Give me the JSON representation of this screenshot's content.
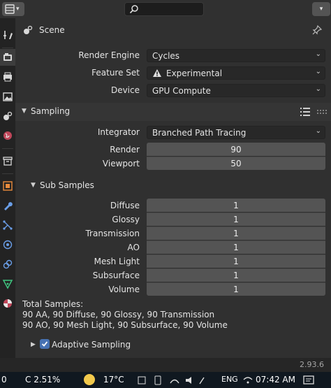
{
  "header": {
    "editor_icon": "properties-editor-icon",
    "search_icon": "search-icon",
    "options_icon": "chevron-down-icon"
  },
  "tabs": [
    {
      "name": "tool",
      "icon": "tool-icon"
    },
    {
      "name": "render",
      "icon": "render-camera-icon",
      "active": true
    },
    {
      "name": "output",
      "icon": "printer-icon"
    },
    {
      "name": "view-layer",
      "icon": "image-icon"
    },
    {
      "name": "scene",
      "icon": "scene-icon"
    },
    {
      "name": "world",
      "icon": "world-icon"
    },
    {
      "name": "collection",
      "icon": "collection-box-icon"
    },
    {
      "name": "object",
      "icon": "object-square-icon"
    },
    {
      "name": "modifiers",
      "icon": "wrench-icon"
    },
    {
      "name": "particles",
      "icon": "particles-icon"
    },
    {
      "name": "physics",
      "icon": "physics-orbit-icon"
    },
    {
      "name": "constraints",
      "icon": "constraint-icon"
    },
    {
      "name": "data",
      "icon": "mesh-data-icon"
    },
    {
      "name": "material",
      "icon": "material-sphere-icon"
    }
  ],
  "context": {
    "scene_label": "Scene"
  },
  "render_settings": {
    "render_engine_label": "Render Engine",
    "render_engine_value": "Cycles",
    "feature_set_label": "Feature Set",
    "feature_set_value": "Experimental",
    "device_label": "Device",
    "device_value": "GPU Compute"
  },
  "sampling": {
    "title": "Sampling",
    "integrator_label": "Integrator",
    "integrator_value": "Branched Path Tracing",
    "render_label": "Render",
    "render_value": "90",
    "viewport_label": "Viewport",
    "viewport_value": "50"
  },
  "sub_samples": {
    "title": "Sub Samples",
    "rows": [
      {
        "label": "Diffuse",
        "value": "1"
      },
      {
        "label": "Glossy",
        "value": "1"
      },
      {
        "label": "Transmission",
        "value": "1"
      },
      {
        "label": "AO",
        "value": "1"
      },
      {
        "label": "Mesh Light",
        "value": "1"
      },
      {
        "label": "Subsurface",
        "value": "1"
      },
      {
        "label": "Volume",
        "value": "1"
      }
    ]
  },
  "totals": {
    "line1": "Total Samples:",
    "line2": "90 AA, 90 Diffuse, 90 Glossy, 90 Transmission",
    "line3": "90 AO, 90 Mesh Light, 90 Subsurface, 90 Volume"
  },
  "adaptive": {
    "label": "Adaptive Sampling",
    "checked": true
  },
  "status": {
    "version": "2.93.6"
  },
  "taskbar": {
    "left_number": "0",
    "stock_text": "C  2.51%",
    "weather": "17°C",
    "language": "ENG",
    "time": "07:42 AM"
  },
  "colors": {
    "accent": "#4772b3",
    "panel_bg": "#303030",
    "field_bg": "#545454",
    "dropdown_bg": "#282828"
  }
}
